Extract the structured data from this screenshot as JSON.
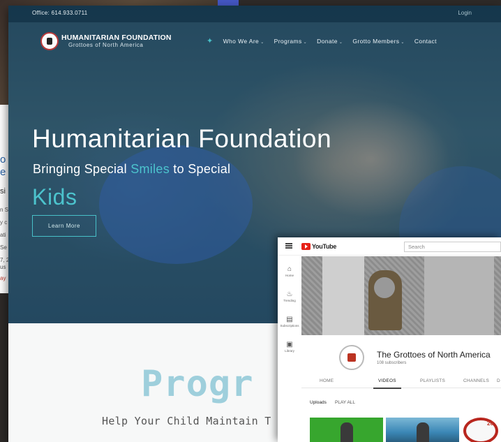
{
  "background": {
    "fragments": [
      "o",
      "e",
      "si",
      "n S",
      "y c",
      "ati",
      "Se",
      "7, 2",
      "us",
      "ay"
    ]
  },
  "site": {
    "topbar": {
      "office": "Office: 614.933.0711",
      "login": "Login"
    },
    "logo": {
      "title": "HUMANITARIAN FOUNDATION",
      "subtitle": "Grottoes of North America"
    },
    "nav": {
      "home_icon": "home-icon",
      "items": [
        {
          "label": "Who We Are",
          "caret": "⌄"
        },
        {
          "label": "Programs",
          "caret": "⌄"
        },
        {
          "label": "Donate",
          "caret": "⌄"
        },
        {
          "label": "Grotto Members",
          "caret": "⌄"
        },
        {
          "label": "Contact",
          "caret": ""
        }
      ]
    },
    "hero": {
      "title": "Humanitarian Foundation",
      "subtitle_pre": "Bringing Special ",
      "subtitle_accent": "Smiles",
      "subtitle_post": " to Special",
      "kids": "Kids",
      "cta": "Learn More"
    },
    "programs": {
      "title": "Progr",
      "subtitle": "Help Your Child Maintain T"
    }
  },
  "youtube": {
    "logo_text": "YouTube",
    "search_placeholder": "Search",
    "sidebar": [
      {
        "icon": "home-icon",
        "glyph": "⌂",
        "label": "Home"
      },
      {
        "icon": "trending-icon",
        "glyph": "♨",
        "label": "Trending"
      },
      {
        "icon": "subscriptions-icon",
        "glyph": "▤",
        "label": "Subscriptions"
      },
      {
        "icon": "library-icon",
        "glyph": "▣",
        "label": "Library"
      }
    ],
    "channel": {
      "name": "The Grottoes of North America",
      "subscribers": "108 subscribers"
    },
    "tabs": [
      {
        "label": "HOME",
        "active": false
      },
      {
        "label": "VIDEOS",
        "active": true
      },
      {
        "label": "PLAYLISTS",
        "active": false
      },
      {
        "label": "CHANNELS",
        "active": false
      },
      {
        "label": "D",
        "active": false
      }
    ],
    "uploads": {
      "label": "Uploads",
      "play_all": "PLAY ALL"
    },
    "thumb3_text": "20",
    "colors": {
      "brand_red": "#e62117",
      "teal_accent": "#4cc3cd"
    }
  }
}
